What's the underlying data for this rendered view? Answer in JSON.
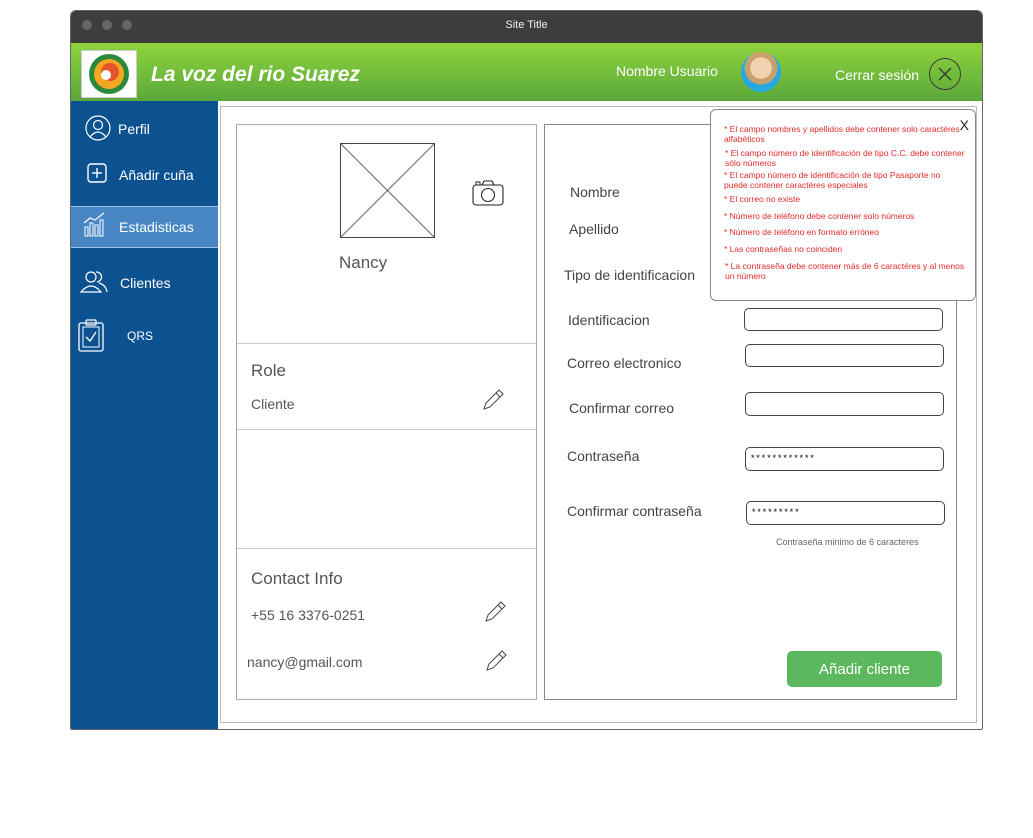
{
  "window": {
    "title": "Site Title"
  },
  "header": {
    "app_title": "La voz del rio Suarez",
    "username": "Nombre Usuario",
    "logout_label": "Cerrar sesión"
  },
  "sidebar": {
    "items": [
      {
        "label": "Perfil",
        "icon": "user-icon"
      },
      {
        "label": "Añadir cuña",
        "icon": "plus-square-icon"
      },
      {
        "label": "Estadisticas",
        "icon": "chart-icon",
        "active": true
      },
      {
        "label": "Clientes",
        "icon": "users-icon"
      },
      {
        "label": "QRS",
        "icon": "clipboard-check-icon"
      }
    ]
  },
  "profile": {
    "name": "Nancy",
    "role_title": "Role",
    "role_value": "Cliente",
    "contact_title": "Contact Info",
    "phone": "+55 16 3376-0251",
    "email": "nancy@gmail.com"
  },
  "form": {
    "labels": {
      "nombre": "Nombre",
      "apellido": "Apellido",
      "tipo_id": "Tipo de identificacion",
      "identificacion": "Identificacion",
      "correo": "Correo electronico",
      "confirmar_correo": "Confirmar correo",
      "contrasena": "Contraseña",
      "confirmar_contrasena": "Confirmar contraseña"
    },
    "values": {
      "identificacion": "",
      "correo": "",
      "confirmar_correo": "",
      "contrasena": "************",
      "confirmar_contrasena": "*********"
    },
    "password_hint": "Contraseña minimo de 6 caracteres",
    "submit_label": "Añadir cliente"
  },
  "validation_popup": {
    "close_label": "X",
    "errors": [
      "* El campo nombres y apellidos debe contener solo caractéres alfabéticos",
      "* El campo número de identificación de tipo C.C. debe contener sólo números",
      "* El campo número de identificación de tipo Pasaporte  no puede contener caractéres especiales",
      "* El correo no existe",
      "* Número de teléfono debe contener solo números",
      "* Número de teléfono en formato erróneo",
      "* Las contraseñas no coinciden",
      "* La contraseña debe contener más de 6 caractéres y al menos un número"
    ]
  },
  "colors": {
    "sidebar_bg": "#0c5290",
    "sidebar_active": "#4887c4",
    "header_green": "#6abf3b",
    "button_green": "#5cb85c",
    "error_red": "#e02b2b"
  }
}
